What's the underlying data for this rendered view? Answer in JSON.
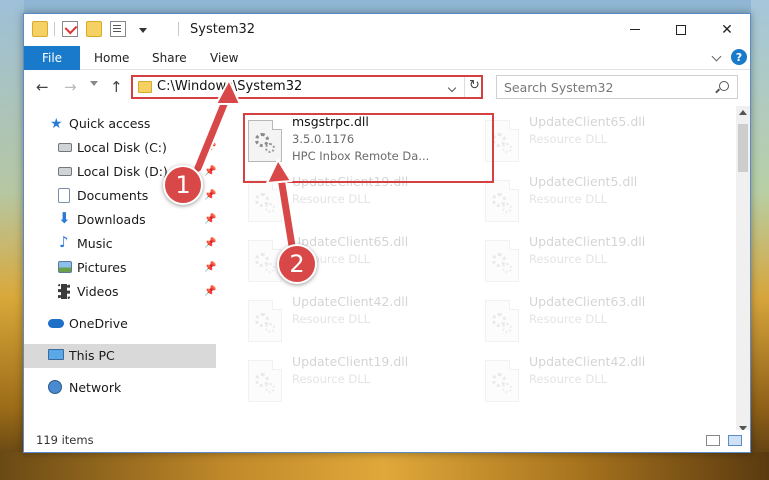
{
  "window": {
    "title": "System32",
    "quick_access_icons": [
      "folder-icon",
      "properties-icon",
      "new-folder-icon",
      "customize-icon"
    ]
  },
  "ribbon": {
    "file": "File",
    "tabs": [
      "Home",
      "Share",
      "View"
    ],
    "help": "?"
  },
  "address": {
    "path": "C:\\Windows\\System32",
    "search_placeholder": "Search System32"
  },
  "sidebar": {
    "items": [
      {
        "label": "Quick access",
        "icon": "star-icon",
        "pinned": false
      },
      {
        "label": "Local Disk (C:)",
        "icon": "drive-icon",
        "pinned": true
      },
      {
        "label": "Local Disk (D:)",
        "icon": "drive-icon",
        "pinned": true
      },
      {
        "label": "Documents",
        "icon": "documents-icon",
        "pinned": true
      },
      {
        "label": "Downloads",
        "icon": "download-icon",
        "pinned": true
      },
      {
        "label": "Music",
        "icon": "music-icon",
        "pinned": true
      },
      {
        "label": "Pictures",
        "icon": "pictures-icon",
        "pinned": true
      },
      {
        "label": "Videos",
        "icon": "videos-icon",
        "pinned": true
      },
      {
        "label": "OneDrive",
        "icon": "cloud-icon",
        "pinned": false
      },
      {
        "label": "This PC",
        "icon": "computer-icon",
        "pinned": false,
        "selected": true
      },
      {
        "label": "Network",
        "icon": "network-icon",
        "pinned": false
      }
    ]
  },
  "files": {
    "highlighted": {
      "name": "msgstrpc.dll",
      "version": "3.5.0.1176",
      "description": "HPC Inbox Remote Da..."
    },
    "faded": [
      {
        "name": "UpdateClient65.dll",
        "type": "Resource DLL"
      },
      {
        "name": "UpdateClient19.dll",
        "type": "Resource DLL"
      },
      {
        "name": "UpdateClient5.dll",
        "type": "Resource DLL"
      },
      {
        "name": "UpdateClient65.dll",
        "type": "Resource DLL"
      },
      {
        "name": "UpdateClient19.dll",
        "type": "Resource DLL"
      },
      {
        "name": "UpdateClient42.dll",
        "type": "Resource DLL"
      },
      {
        "name": "UpdateClient63.dll",
        "type": "Resource DLL"
      },
      {
        "name": "UpdateClient19.dll",
        "type": "Resource DLL"
      },
      {
        "name": "UpdateClient42.dll",
        "type": "Resource DLL"
      }
    ]
  },
  "status": {
    "item_count": "119 items"
  },
  "annotations": {
    "step1": "1",
    "step2": "2",
    "color": "#d64040"
  }
}
